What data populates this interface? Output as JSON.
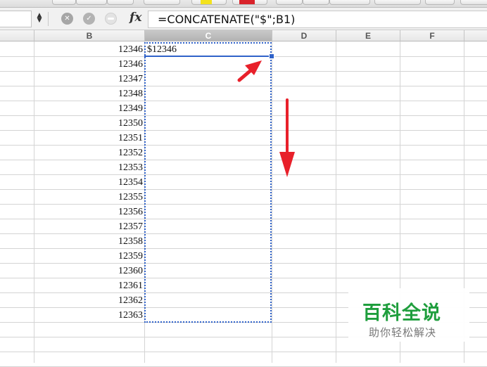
{
  "formula_bar": {
    "name_box_value": "",
    "fx_label": "fx",
    "formula": "=CONCATENATE(\"$\";B1)"
  },
  "columns": [
    "",
    "B",
    "C",
    "D",
    "E",
    "F"
  ],
  "selected_column": "C",
  "column_b_values": [
    "12346",
    "12346",
    "12347",
    "12348",
    "12349",
    "12350",
    "12351",
    "12352",
    "12353",
    "12354",
    "12355",
    "12356",
    "12357",
    "12358",
    "12359",
    "12360",
    "12361",
    "12362",
    "12363"
  ],
  "column_c_values": [
    "$12346"
  ],
  "colors": {
    "selection": "#2f62c9",
    "annotation_arrow": "#e8202a",
    "watermark_title": "#1f9e3d"
  },
  "watermark": {
    "title": "百科全说",
    "subtitle": "助你轻松解决"
  }
}
